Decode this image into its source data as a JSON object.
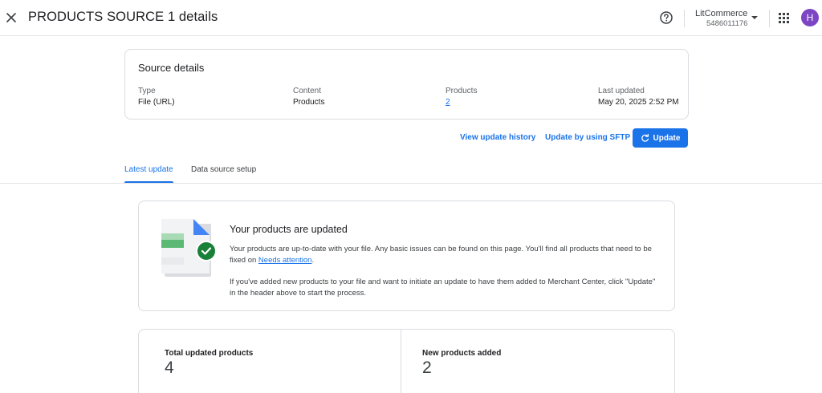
{
  "header": {
    "title": "PRODUCTS SOURCE 1 details",
    "close_icon": "close-icon",
    "help_icon": "help-circle-icon",
    "account": {
      "name": "LitCommerce",
      "id": "5486011176"
    },
    "apps_icon": "apps-grid-icon",
    "avatar_initial": "H",
    "avatar_color": "#7b45c4"
  },
  "source_details": {
    "title": "Source details",
    "fields": [
      {
        "label": "Type",
        "value": "File (URL)"
      },
      {
        "label": "Content",
        "value": "Products"
      },
      {
        "label": "Products",
        "value": "2"
      },
      {
        "label": "Last updated",
        "value": "May 20, 2025 2:52 PM"
      }
    ]
  },
  "actions": {
    "view_history": "View update history",
    "sftp": "Update by using SFTP",
    "update": "Update"
  },
  "tabs": [
    {
      "label": "Latest update",
      "active": true
    },
    {
      "label": "Data source setup",
      "active": false
    }
  ],
  "status": {
    "title": "Your products are updated",
    "para1_before": "Your products are up-to-date with your file. Any basic issues can be found on this page. You'll find all products that need to be fixed on ",
    "para1_link": "Needs attention",
    "para1_after": ".",
    "para2": "If you've added new products to your file and want to initiate an update to have them added to Merchant Center, click \"Update\" in the header above to start the process."
  },
  "stats": [
    {
      "label": "Total updated products",
      "value": "4"
    },
    {
      "label": "New products added",
      "value": "2"
    }
  ],
  "colors": {
    "accent": "#1a73e8",
    "success": "#188038",
    "illustration_green": "#5bb974"
  }
}
